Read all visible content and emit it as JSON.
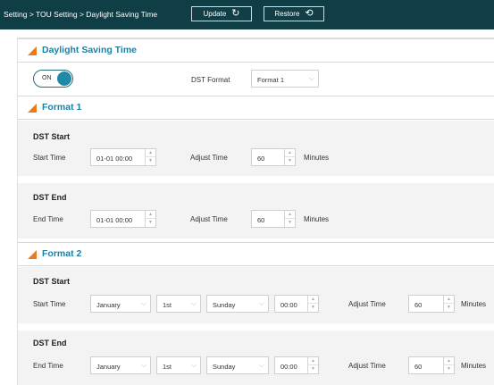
{
  "breadcrumb": "Setting > TOU Setting > Daylight Saving Time",
  "toolbar": {
    "update_label": "Update",
    "restore_label": "Restore"
  },
  "dst": {
    "title": "Daylight Saving Time",
    "toggle_label": "ON",
    "format_label": "DST Format",
    "format_value": "Format 1"
  },
  "format1": {
    "title": "Format 1",
    "start": {
      "title": "DST Start",
      "time_label": "Start Time",
      "time_value": "01-01 00:00",
      "adjust_label": "Adjust Time",
      "adjust_value": "60",
      "unit": "Minutes"
    },
    "end": {
      "title": "DST End",
      "time_label": "End Time",
      "time_value": "01-01 00:00",
      "adjust_label": "Adjust Time",
      "adjust_value": "60",
      "unit": "Minutes"
    }
  },
  "format2": {
    "title": "Format 2",
    "start": {
      "title": "DST Start",
      "time_label": "Start Time",
      "month": "January",
      "week": "1st",
      "day": "Sunday",
      "time": "00:00",
      "adjust_label": "Adjust Time",
      "adjust_value": "60",
      "unit": "Minutes"
    },
    "end": {
      "title": "DST End",
      "time_label": "End Time",
      "month": "January",
      "week": "1st",
      "day": "Sunday",
      "time": "00:00",
      "adjust_label": "Adjust Time",
      "adjust_value": "60",
      "unit": "Minutes"
    }
  },
  "icons": {
    "update": "refresh-icon",
    "restore": "history-icon",
    "section": "orange-triangle-icon"
  },
  "colors": {
    "topbar": "#0f3e46",
    "accent": "#1e7fa0",
    "toggle": "#1f8aa8",
    "triangle": "#e87b1e"
  }
}
